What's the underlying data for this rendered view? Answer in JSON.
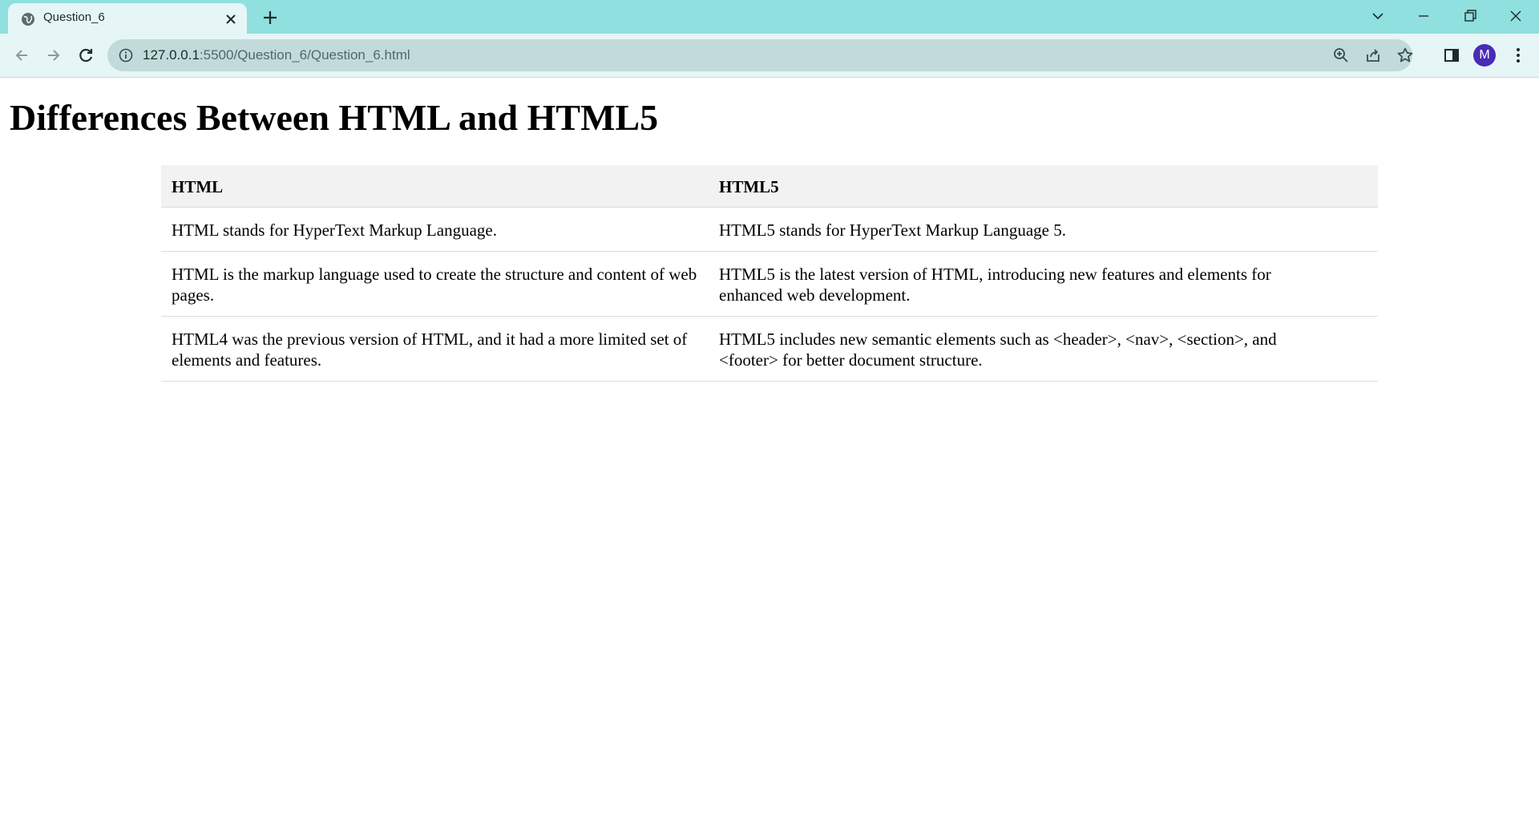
{
  "browser": {
    "tab": {
      "title": "Question_6"
    },
    "address_bar": {
      "url_host": "127.0.0.1",
      "url_rest": ":5500/Question_6/Question_6.html"
    },
    "profile": {
      "initial": "M",
      "color": "#4a2bb8"
    },
    "colors": {
      "tabstrip": "#8fe0de",
      "toolbar": "#e6f6f6",
      "omnibox": "#c2dada"
    }
  },
  "page": {
    "title": "Differences Between HTML and HTML5",
    "table": {
      "headers": [
        "HTML",
        "HTML5"
      ],
      "rows": [
        [
          "HTML stands for HyperText Markup Language.",
          "HTML5 stands for HyperText Markup Language 5."
        ],
        [
          "HTML is the markup language used to create the structure and content of web pages.",
          "HTML5 is the latest version of HTML, introducing new features and elements for enhanced web development."
        ],
        [
          "HTML4 was the previous version of HTML, and it had a more limited set of elements and features.",
          "HTML5 includes new semantic elements such as <header>, <nav>, <section>, and <footer> for better document structure."
        ]
      ]
    }
  }
}
